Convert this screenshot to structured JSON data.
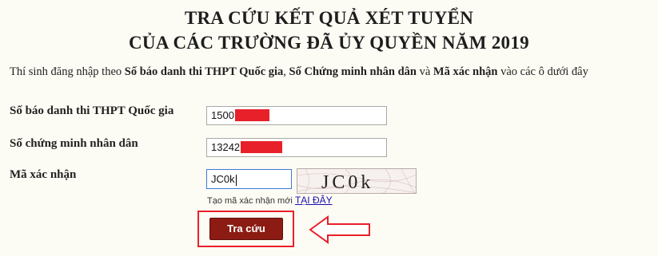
{
  "header": {
    "title_line1": "TRA CỨU KẾT QUẢ XÉT TUYỂN",
    "title_line2": "CỦA CÁC TRƯỜNG ĐÃ ỦY QUYỀN NĂM 2019"
  },
  "instruction": {
    "prefix": "Thí sinh đăng nhập theo ",
    "bold1": "Số báo danh thi THPT Quốc gia",
    "sep1": ", ",
    "bold2": "Số Chứng minh nhân dân",
    "sep2": " và ",
    "bold3": "Mã xác nhận",
    "suffix": " vào các ô dưới đây"
  },
  "form": {
    "sbd_label": "Số báo danh thi THPT Quốc gia",
    "sbd_value": "1500",
    "cmnd_label": "Số chứng minh nhân dân",
    "cmnd_value": "13242",
    "captcha_label": "Mã xác nhận",
    "captcha_value": "JC0k",
    "captcha_image_text": "JC0k",
    "captcha_hint": "Tạo mã xác nhận mới ",
    "captcha_hint_link": "TẠI ĐÂY",
    "submit_label": "Tra cứu"
  },
  "colors": {
    "redaction": "#e8202a",
    "button_bg": "#8c1c13",
    "highlight": "#e8202a"
  }
}
